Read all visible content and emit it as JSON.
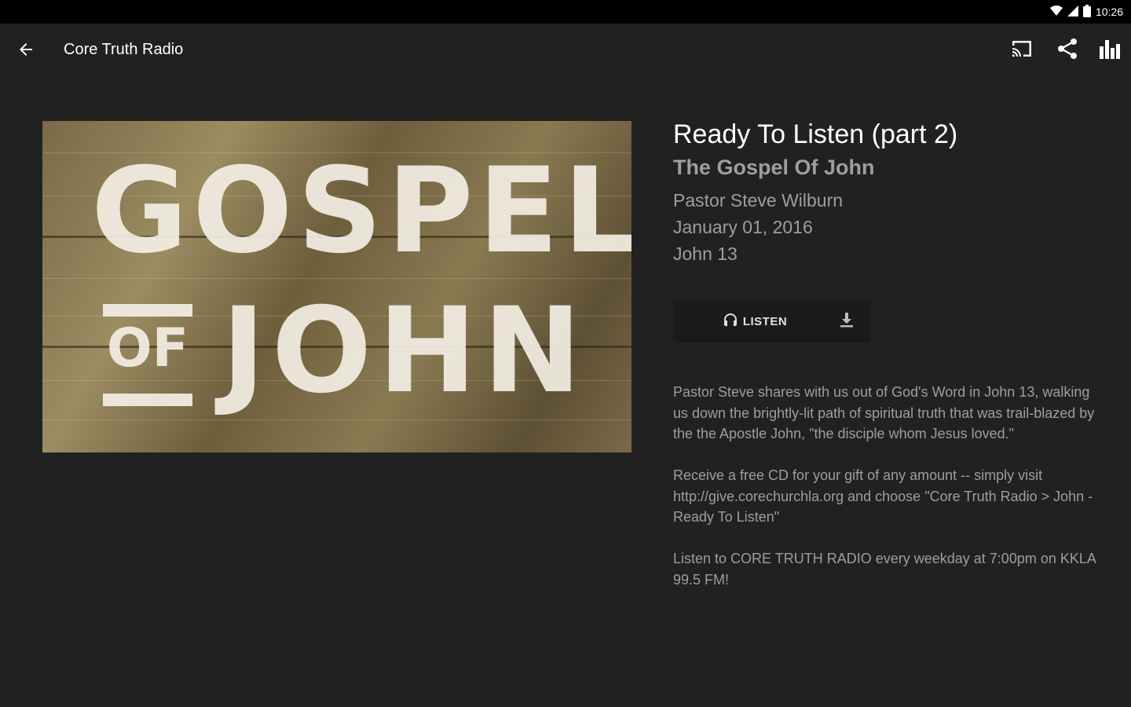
{
  "status_bar": {
    "time": "10:26",
    "icons": [
      "wifi-icon",
      "signal-icon",
      "battery-icon"
    ]
  },
  "toolbar": {
    "back_icon": "arrow-back-icon",
    "title": "Core Truth Radio",
    "actions": [
      "cast-icon",
      "share-icon",
      "equalizer-icon"
    ]
  },
  "artwork": {
    "line1": "GOSPEL",
    "of": "OF",
    "line2": "JOHN"
  },
  "episode": {
    "title": "Ready To Listen (part 2)",
    "series": "The Gospel Of John",
    "speaker": "Pastor Steve Wilburn",
    "date": "January 01, 2016",
    "passage": "John 13"
  },
  "actions": {
    "listen_label": "LISTEN",
    "listen_icon": "headphones-icon",
    "download_icon": "download-icon"
  },
  "description": {
    "paragraphs": [
      "Pastor Steve shares with us out of God's Word in John 13, walking us down the brightly-lit path of spiritual truth that was trail-blazed by the the Apostle John, \"the disciple whom Jesus loved.\"",
      "Receive a free CD for your gift of any amount -- simply visit http://give.corechurchla.org and choose \"Core Truth Radio > John - Ready To Listen\"",
      "Listen to CORE TRUTH RADIO every weekday at 7:00pm on KKLA 99.5 FM!"
    ]
  },
  "colors": {
    "background": "#212121",
    "status_bar": "#000000",
    "primary_text": "#ffffff",
    "secondary_text": "#9e9e9e"
  }
}
